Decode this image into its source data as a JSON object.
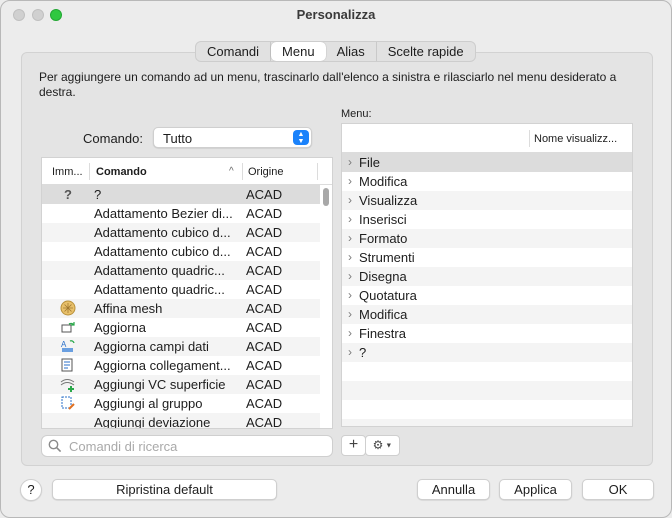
{
  "window": {
    "title": "Personalizza"
  },
  "tabs": [
    {
      "label": "Comandi",
      "active": false
    },
    {
      "label": "Menu",
      "active": true
    },
    {
      "label": "Alias",
      "active": false
    },
    {
      "label": "Scelte rapide",
      "active": false
    }
  ],
  "instructions": "Per aggiungere un comando ad un menu, trascinarlo dall'elenco a sinistra e rilasciarlo nel menu desiderato a destra.",
  "command_filter": {
    "label": "Comando:",
    "value": "Tutto"
  },
  "command_table": {
    "headers": {
      "image": "Imm...",
      "command": "Comando",
      "origin": "Origine"
    },
    "rows": [
      {
        "icon": "question-icon",
        "name": "?",
        "origin": "ACAD"
      },
      {
        "icon": "",
        "name": "Adattamento Bezier di...",
        "origin": "ACAD"
      },
      {
        "icon": "",
        "name": "Adattamento cubico d...",
        "origin": "ACAD"
      },
      {
        "icon": "",
        "name": "Adattamento cubico d...",
        "origin": "ACAD"
      },
      {
        "icon": "",
        "name": "Adattamento quadric...",
        "origin": "ACAD"
      },
      {
        "icon": "",
        "name": "Adattamento quadric...",
        "origin": "ACAD"
      },
      {
        "icon": "mesh-refine-icon",
        "name": "Affina mesh",
        "origin": "ACAD"
      },
      {
        "icon": "refresh-icon",
        "name": "Aggiorna",
        "origin": "ACAD"
      },
      {
        "icon": "update-fields-icon",
        "name": "Aggiorna campi dati",
        "origin": "ACAD"
      },
      {
        "icon": "update-links-icon",
        "name": "Aggiorna collegament...",
        "origin": "ACAD"
      },
      {
        "icon": "add-surface-cv-icon",
        "name": "Aggiungi VC superficie",
        "origin": "ACAD"
      },
      {
        "icon": "add-to-group-icon",
        "name": "Aggiungi al gruppo",
        "origin": "ACAD"
      },
      {
        "icon": "",
        "name": "Aggiungi deviazione",
        "origin": "ACAD"
      }
    ]
  },
  "search": {
    "placeholder": "Comandi di ricerca",
    "value": ""
  },
  "menu_panel": {
    "label": "Menu:",
    "column_header": "Nome visualizz...",
    "items": [
      "File",
      "Modifica",
      "Visualizza",
      "Inserisci",
      "Formato",
      "Strumenti",
      "Disegna",
      "Quotatura",
      "Modifica",
      "Finestra",
      "?"
    ]
  },
  "buttons": {
    "help": "?",
    "reset": "Ripristina default",
    "cancel": "Annulla",
    "apply": "Applica",
    "ok": "OK",
    "add": "+"
  },
  "colors": {
    "accent": "#1a82fb",
    "selection": "#dcdcdc"
  }
}
